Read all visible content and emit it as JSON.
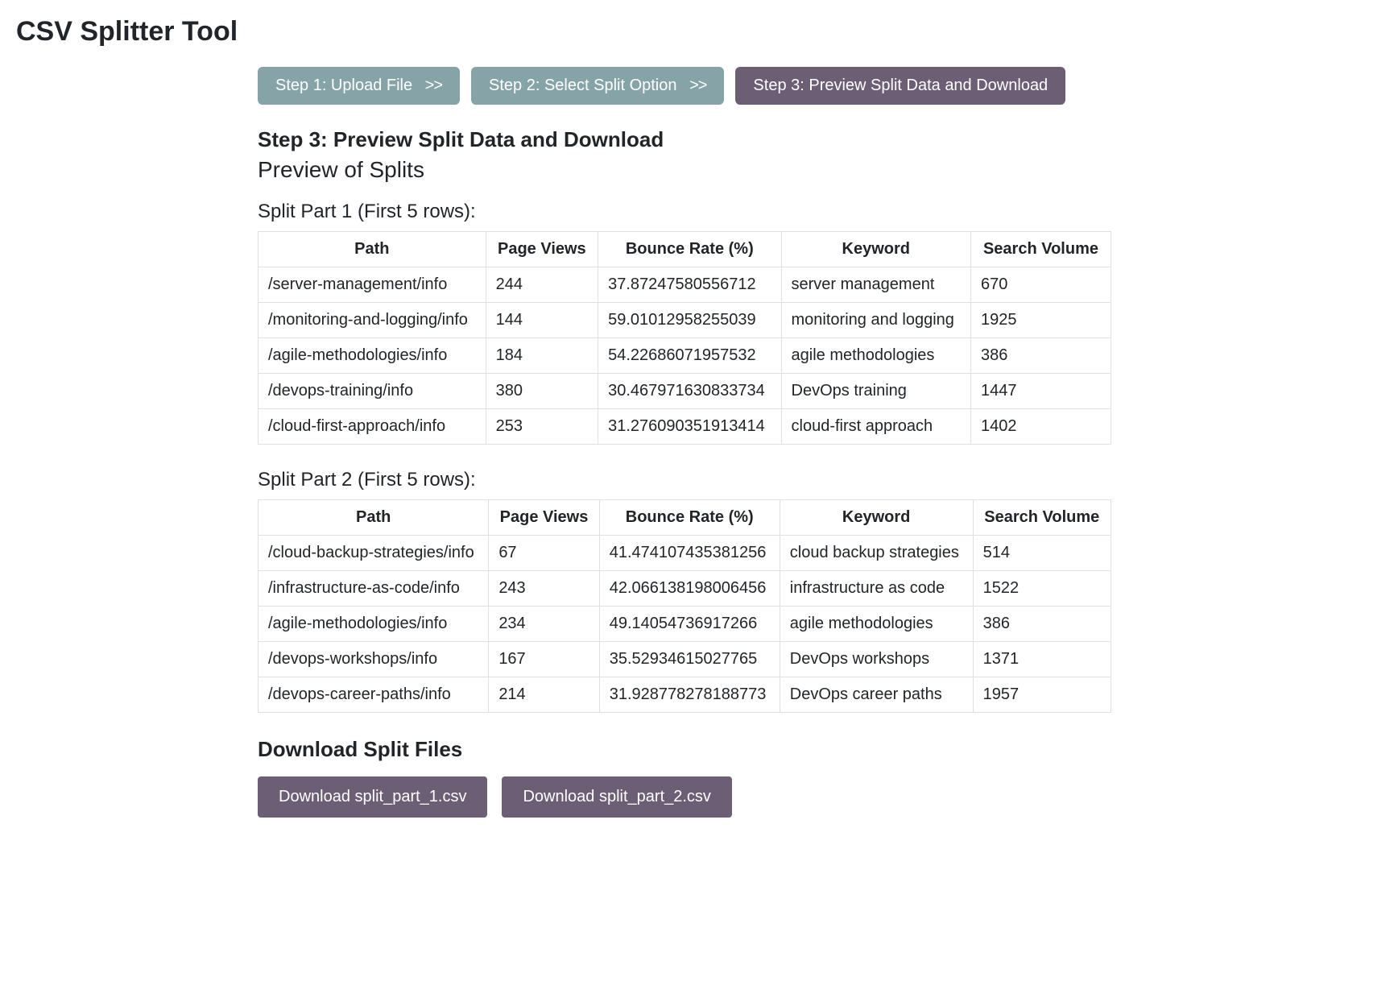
{
  "page_title": "CSV Splitter Tool",
  "steps": {
    "step1": {
      "label": "Step 1: Upload File",
      "chevron": ">>"
    },
    "step2": {
      "label": "Step 2: Select Split Option",
      "chevron": ">>"
    },
    "step3": {
      "label": "Step 3: Preview Split Data and Download"
    }
  },
  "current_step_title": "Step 3: Preview Split Data and Download",
  "preview_heading": "Preview of Splits",
  "columns": [
    "Path",
    "Page Views",
    "Bounce Rate (%)",
    "Keyword",
    "Search Volume"
  ],
  "splits": [
    {
      "title": "Split Part 1 (First 5 rows):",
      "rows": [
        {
          "path": "/server-management/info",
          "page_views": "244",
          "bounce_rate": "37.87247580556712",
          "keyword": "server management",
          "search_volume": "670"
        },
        {
          "path": "/monitoring-and-logging/info",
          "page_views": "144",
          "bounce_rate": "59.01012958255039",
          "keyword": "monitoring and logging",
          "search_volume": "1925"
        },
        {
          "path": "/agile-methodologies/info",
          "page_views": "184",
          "bounce_rate": "54.22686071957532",
          "keyword": "agile methodologies",
          "search_volume": "386"
        },
        {
          "path": "/devops-training/info",
          "page_views": "380",
          "bounce_rate": "30.467971630833734",
          "keyword": "DevOps training",
          "search_volume": "1447"
        },
        {
          "path": "/cloud-first-approach/info",
          "page_views": "253",
          "bounce_rate": "31.276090351913414",
          "keyword": "cloud-first approach",
          "search_volume": "1402"
        }
      ]
    },
    {
      "title": "Split Part 2 (First 5 rows):",
      "rows": [
        {
          "path": "/cloud-backup-strategies/info",
          "page_views": "67",
          "bounce_rate": "41.474107435381256",
          "keyword": "cloud backup strategies",
          "search_volume": "514"
        },
        {
          "path": "/infrastructure-as-code/info",
          "page_views": "243",
          "bounce_rate": "42.066138198006456",
          "keyword": "infrastructure as code",
          "search_volume": "1522"
        },
        {
          "path": "/agile-methodologies/info",
          "page_views": "234",
          "bounce_rate": "49.14054736917266",
          "keyword": "agile methodologies",
          "search_volume": "386"
        },
        {
          "path": "/devops-workshops/info",
          "page_views": "167",
          "bounce_rate": "35.52934615027765",
          "keyword": "DevOps workshops",
          "search_volume": "1371"
        },
        {
          "path": "/devops-career-paths/info",
          "page_views": "214",
          "bounce_rate": "31.928778278188773",
          "keyword": "DevOps career paths",
          "search_volume": "1957"
        }
      ]
    }
  ],
  "download": {
    "heading": "Download Split Files",
    "buttons": [
      {
        "label": "Download split_part_1.csv"
      },
      {
        "label": "Download split_part_2.csv"
      }
    ]
  }
}
